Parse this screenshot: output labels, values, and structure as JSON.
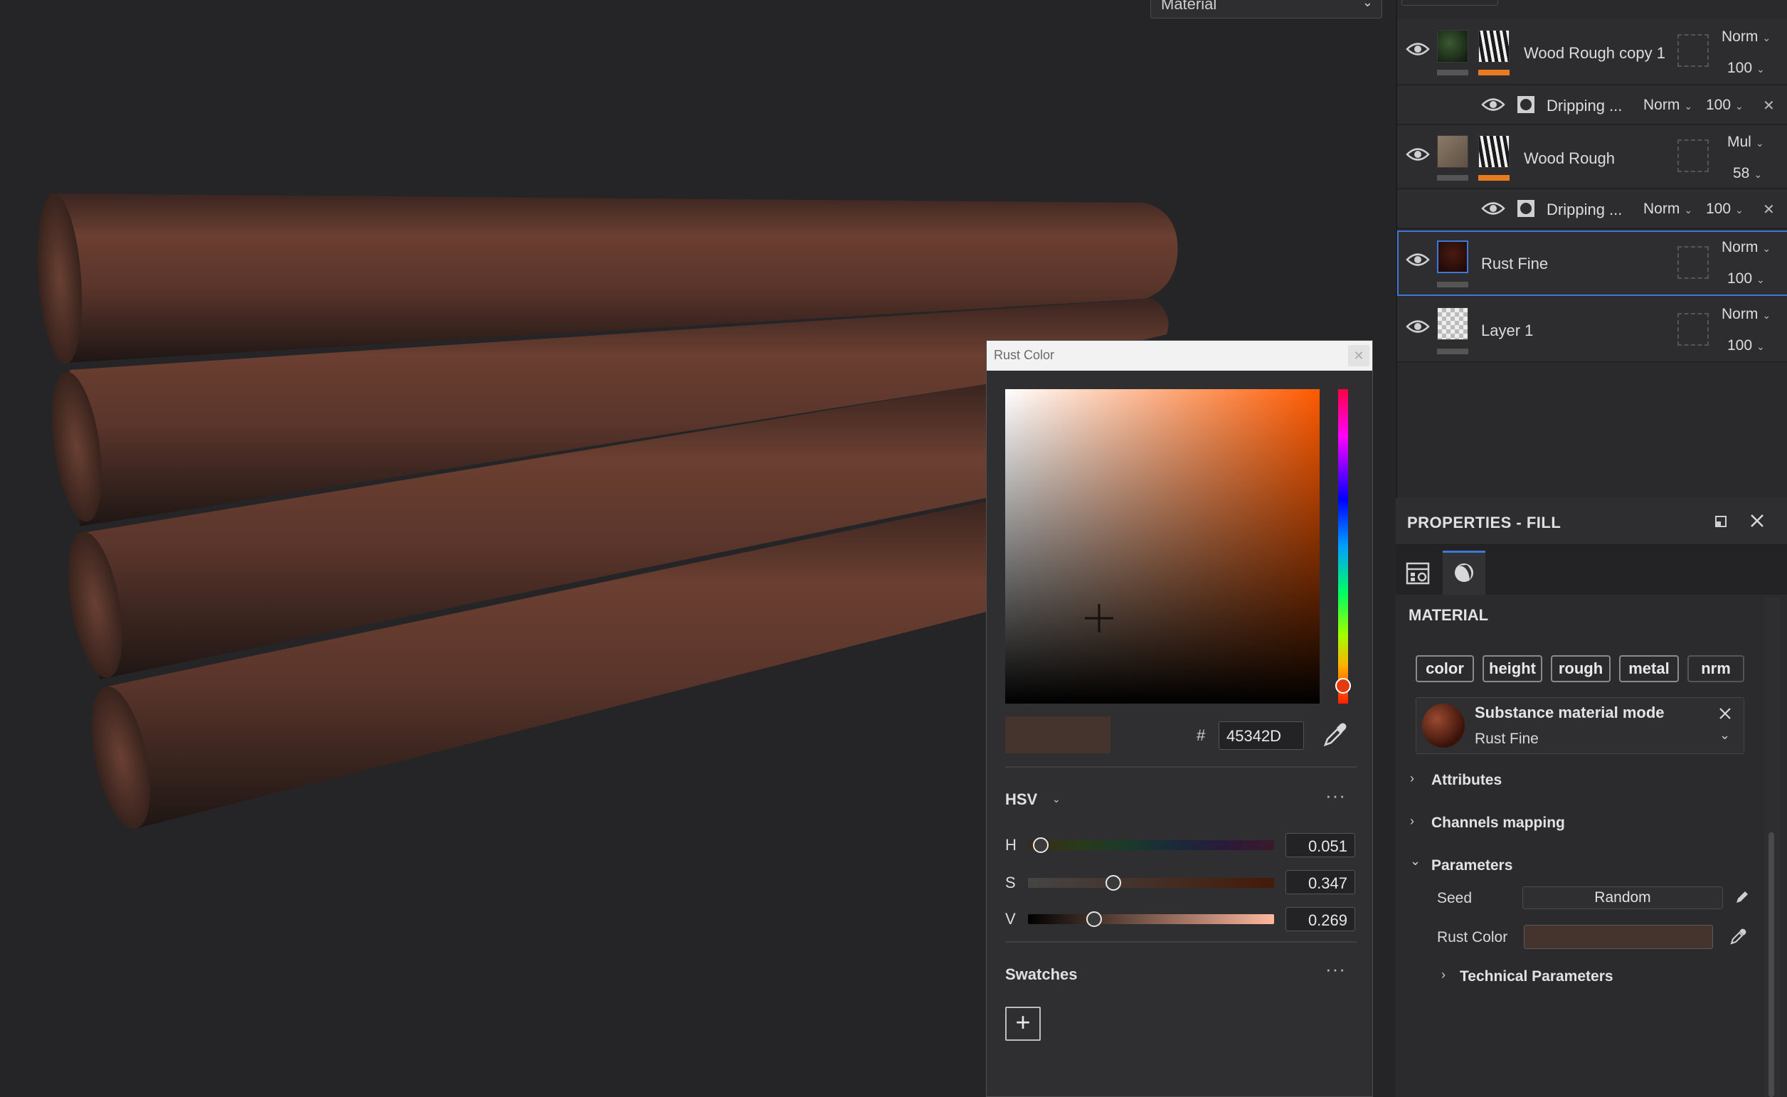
{
  "viewport": {
    "dropdown_value": "Material"
  },
  "layers": [
    {
      "name": "Wood Rough copy 1",
      "blend": "Norm",
      "opacity": "100",
      "mask_strip": "orange",
      "sub": {
        "name": "Dripping ...",
        "blend": "Norm",
        "opacity": "100"
      }
    },
    {
      "name": "Wood Rough",
      "blend": "Mul",
      "opacity": "58",
      "mask_strip": "orange",
      "sub": {
        "name": "Dripping ...",
        "blend": "Norm",
        "opacity": "100"
      }
    },
    {
      "name": "Rust Fine",
      "blend": "Norm",
      "opacity": "100",
      "selected": true
    },
    {
      "name": "Layer 1",
      "blend": "Norm",
      "opacity": "100"
    }
  ],
  "properties": {
    "title": "PROPERTIES - FILL",
    "material_heading": "MATERIAL",
    "channels": [
      "color",
      "height",
      "rough",
      "metal",
      "nrm"
    ],
    "material_mode_title": "Substance material mode",
    "material_name": "Rust Fine",
    "sections": {
      "attributes": "Attributes",
      "channels_mapping": "Channels mapping",
      "parameters": "Parameters",
      "technical": "Technical Parameters"
    },
    "seed_label": "Seed",
    "seed_value": "Random",
    "rust_color_label": "Rust Color",
    "rust_color_hex": "#45342D"
  },
  "picker": {
    "title": "Rust Color",
    "hash": "#",
    "hex": "45342D",
    "mode": "HSV",
    "sliders": [
      {
        "label": "H",
        "value": "0.051",
        "fraction": 0.051
      },
      {
        "label": "S",
        "value": "0.347",
        "fraction": 0.347
      },
      {
        "label": "V",
        "value": "0.269",
        "fraction": 0.269
      }
    ],
    "swatches_label": "Swatches",
    "add_symbol": "+"
  },
  "colors": {
    "selection": "#3d78d8",
    "mask_strip": "#e87a22",
    "rust_color": "#45342D"
  }
}
